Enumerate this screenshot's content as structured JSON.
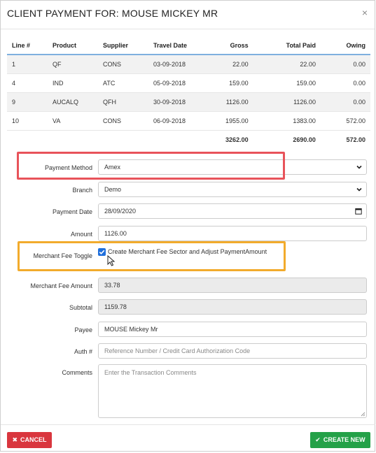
{
  "dialog": {
    "title": "CLIENT PAYMENT FOR: MOUSE MICKEY MR",
    "close_icon": "×"
  },
  "lines_table": {
    "headers": [
      "Line #",
      "Product",
      "Supplier",
      "Travel Date",
      "Gross",
      "Total Paid",
      "Owing"
    ],
    "rows": [
      [
        "1",
        "QF",
        "CONS",
        "03-09-2018",
        "22.00",
        "22.00",
        "0.00"
      ],
      [
        "4",
        "IND",
        "ATC",
        "05-09-2018",
        "159.00",
        "159.00",
        "0.00"
      ],
      [
        "9",
        "AUCALQ",
        "QFH",
        "30-09-2018",
        "1126.00",
        "1126.00",
        "0.00"
      ],
      [
        "10",
        "VA",
        "CONS",
        "06-09-2018",
        "1955.00",
        "1383.00",
        "572.00"
      ]
    ],
    "totals": {
      "gross": "3262.00",
      "paid": "2690.00",
      "owing": "572.00"
    }
  },
  "form": {
    "payment_method": {
      "label": "Payment Method",
      "value": "Amex"
    },
    "branch": {
      "label": "Branch",
      "value": "Demo"
    },
    "payment_date": {
      "label": "Payment Date",
      "value": "28/09/2020"
    },
    "amount": {
      "label": "Amount",
      "value": "1126.00"
    },
    "merchant_fee_toggle": {
      "label": "Merchant Fee Toggle",
      "checkbox_label": "Create Merchant Fee Sector and Adjust PaymentAmount",
      "checked": true
    },
    "merchant_fee_amount": {
      "label": "Merchant Fee Amount",
      "value": "33.78"
    },
    "subtotal": {
      "label": "Subtotal",
      "value": "1159.78"
    },
    "payee": {
      "label": "Payee",
      "value": "MOUSE Mickey Mr"
    },
    "auth": {
      "label": "Auth #",
      "placeholder": "Reference Number / Credit Card Authorization Code"
    },
    "comments": {
      "label": "Comments",
      "placeholder": "Enter the Transaction Comments"
    }
  },
  "footer": {
    "cancel_label": "CANCEL",
    "create_label": "CREATE NEW"
  },
  "colors": {
    "cancel_red": "#d9363e",
    "create_green": "#24a148",
    "highlight_red": "#e8535a",
    "highlight_orange": "#f2ab2c",
    "header_underline": "#7fb0df"
  }
}
